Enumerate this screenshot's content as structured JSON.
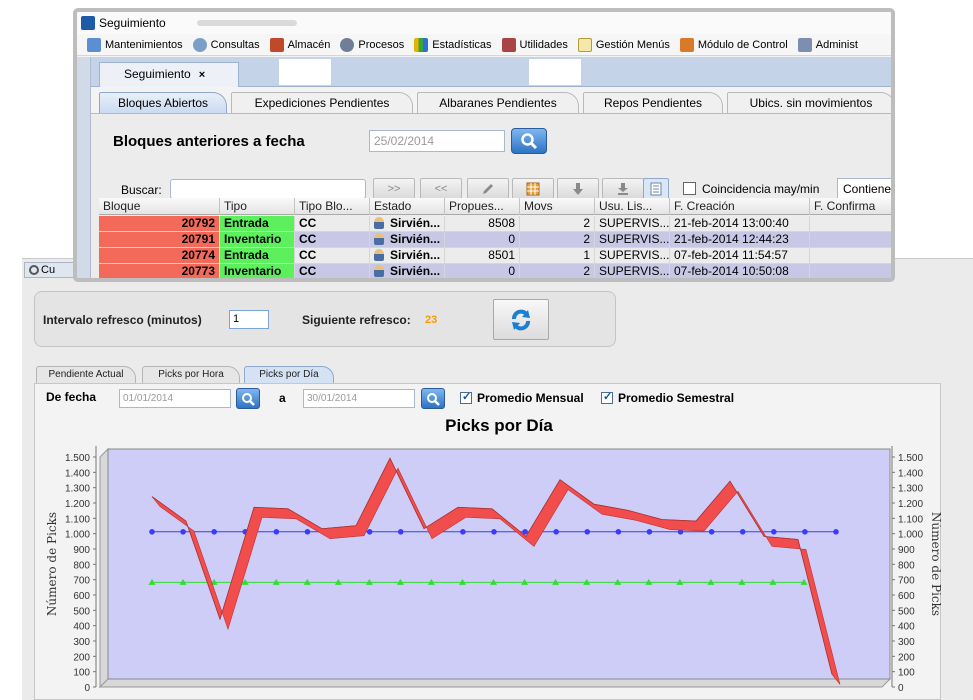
{
  "background": {
    "tab_label": "Cu",
    "refresh": {
      "interval_label": "Intervalo refresco (minutos)",
      "interval_value": "1",
      "next_label": "Siguiente refresco:",
      "next_value": "23"
    },
    "chart_tabs": [
      "Pendiente Actual",
      "Picks por Hora",
      "Picks por Día"
    ],
    "active_chart_tab": 2,
    "filters": {
      "from_label": "De fecha",
      "from_value": "01/01/2014",
      "to_label": "a",
      "to_value": "30/01/2014",
      "monthly_avg_label": "Promedio Mensual",
      "semester_avg_label": "Promedio Semestral"
    },
    "colors": {
      "accent_orange": "#ff9900",
      "plot_bg": "#cdcdf7",
      "series_red": "#f24d4d",
      "monthly_avg": "#3b3bff",
      "semester_avg": "#33dd33"
    }
  },
  "chart_data": {
    "type": "line",
    "title": "Picks por Día",
    "ylabel": "Número de Picks",
    "ylabel_right": "Número de Picks",
    "ylim": [
      0,
      1500
    ],
    "yticks": [
      "0",
      "100",
      "200",
      "300",
      "400",
      "500",
      "600",
      "700",
      "800",
      "900",
      "1.000",
      "1.100",
      "1.200",
      "1.300",
      "1.400",
      "1.500"
    ],
    "series": [
      {
        "values": [
          1190,
          1030,
          390,
          1120,
          1110,
          980,
          1000,
          1440,
          980,
          1120,
          1110,
          930,
          1300,
          1140,
          1100,
          1040,
          1030,
          1290,
          930,
          910,
          30
        ]
      },
      {
        "name": "Promedio Mensual",
        "values": [
          960,
          960,
          960,
          960,
          960,
          960,
          960,
          960,
          960,
          960,
          960,
          960,
          960,
          960,
          960,
          960,
          960,
          960,
          960,
          960,
          960,
          960,
          960
        ]
      },
      {
        "name": "Promedio Semestral",
        "values": [
          630,
          630,
          630,
          630,
          630,
          630,
          630,
          630,
          630,
          630,
          630,
          630,
          630,
          630,
          630,
          630,
          630,
          630,
          630,
          630,
          630,
          630
        ]
      }
    ],
    "grid": false,
    "legend": "none"
  },
  "foreground": {
    "window_title": "Seguimiento",
    "menu": [
      "Mantenimientos",
      "Consultas",
      "Almacén",
      "Procesos",
      "Estadísticas",
      "Utilidades",
      "Gestión Menús",
      "Módulo de Control",
      "Administ"
    ],
    "menu_icons": [
      "window-icon",
      "magnifier-icon",
      "archive-icon",
      "gear-icon",
      "bar-chart-icon",
      "tools-icon",
      "menu-editor-icon",
      "control-icon",
      "admin-icon"
    ],
    "doc_tab": {
      "label": "Seguimiento",
      "close": "×"
    },
    "sub_tabs": [
      "Bloques Abiertos",
      "Expediciones Pendientes",
      "Albaranes Pendientes",
      "Repos Pendientes",
      "Ubics. sin movimientos"
    ],
    "active_sub_tab": 0,
    "section_title": "Bloques anteriores a fecha",
    "fecha_value": "25/02/2014",
    "buscar_label": "Buscar:",
    "toolbar_labels": [
      ">>",
      "<<"
    ],
    "coincidencia_label": "Coincidencia may/min",
    "contiene_value": "Contiene",
    "columns": [
      "Bloque",
      "Tipo",
      "Tipo Blo...",
      "Estado",
      "Propues...",
      "Movs",
      "Usu. Lis...",
      "F. Creación",
      "F. Confirma"
    ],
    "rows": [
      {
        "bloque": "20792",
        "tipo": "Entrada",
        "tipo_blo": "CC",
        "estado": "Sirvién...",
        "propues": "8508",
        "movs": "2",
        "usu": "SUPERVIS...",
        "f_creacion": "21-feb-2014 13:00:40",
        "f_confirma": ""
      },
      {
        "bloque": "20791",
        "tipo": "Inventario",
        "tipo_blo": "CC",
        "estado": "Sirvién...",
        "propues": "0",
        "movs": "2",
        "usu": "SUPERVIS...",
        "f_creacion": "21-feb-2014 12:44:23",
        "f_confirma": ""
      },
      {
        "bloque": "20774",
        "tipo": "Entrada",
        "tipo_blo": "CC",
        "estado": "Sirvién...",
        "propues": "8501",
        "movs": "1",
        "usu": "SUPERVIS...",
        "f_creacion": "07-feb-2014 11:54:57",
        "f_confirma": ""
      },
      {
        "bloque": "20773",
        "tipo": "Inventario",
        "tipo_blo": "CC",
        "estado": "Sirvién...",
        "propues": "0",
        "movs": "2",
        "usu": "SUPERVIS...",
        "f_creacion": "07-feb-2014 10:50:08",
        "f_confirma": ""
      }
    ],
    "colors": {
      "bloque_cell": "#f46a5a",
      "tipo_cell": "#5cf05c",
      "alt_row": "#c8c8e6"
    }
  }
}
